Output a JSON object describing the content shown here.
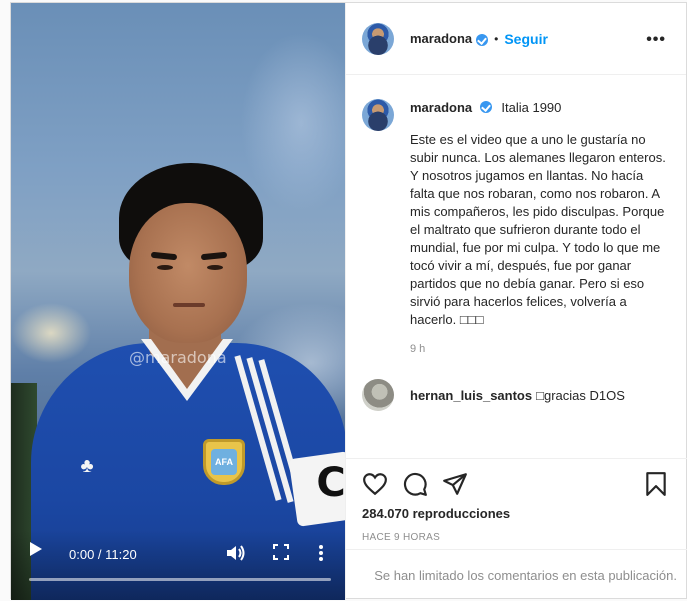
{
  "post": {
    "username": "maradona",
    "follow_label": "Seguir",
    "dot": "•",
    "more_label": "•••",
    "location": "Italia 1990",
    "caption": "Este es el video que a uno le gustaría no subir nunca. Los alemanes llegaron enteros. Y nosotros jugamos en llantas. No hacía falta que nos robaran, como nos robaron. A mis compañeros, les pido disculpas. Porque el maltrato que sufrieron durante todo el mundial, fue por mi culpa. Y todo lo que me tocó vivir a mí, después, fue por ganar partidos que no debía ganar. Pero si eso sirvió para hacerlos felices, volvería a hacerlo. □□□",
    "caption_time": "9 h",
    "views": "284.070 reproducciones",
    "posted_ago": "HACE 9 HORAS",
    "comments_limited": "Se han limitado los comentarios en esta publicación."
  },
  "comments": [
    {
      "username": "hernan_luis_santos",
      "text": "□gracias D1OS"
    }
  ],
  "video": {
    "time": "0:00 / 11:20",
    "watermark": "@maradona",
    "armband_letter": "C",
    "crest_text": "AFA",
    "progress": 0
  },
  "icons": {
    "play": "play-icon",
    "volume": "volume-icon",
    "fullscreen": "fullscreen-icon",
    "options": "more-vertical-icon",
    "like": "heart-icon",
    "comment": "comment-icon",
    "share": "share-icon",
    "save": "bookmark-icon",
    "verified": "verified-badge-icon",
    "more": "more-horizontal-icon"
  },
  "colors": {
    "follow": "#0095f6",
    "verified": "#3897f0",
    "muted": "#8e8e8e"
  }
}
